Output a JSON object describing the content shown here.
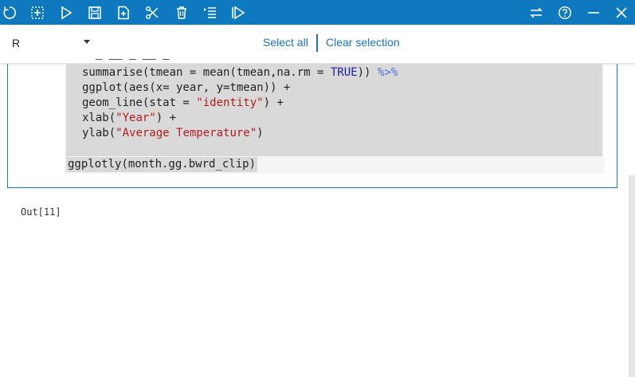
{
  "toolbar": {
    "icons": [
      "restart-kernel-icon",
      "insert-cell-icon",
      "run-icon",
      "save-icon",
      "new-notebook-icon",
      "cut-icon",
      "delete-icon",
      "run-all-icon",
      "run-all-below-icon",
      "sync-icon",
      "help-icon",
      "minimize-icon",
      "close-icon"
    ],
    "color": "#0f79c0"
  },
  "subbar": {
    "kernel": "R",
    "select_all": "Select all",
    "clear_selection": "Clear selection",
    "link_color": "#1a73c8"
  },
  "cell": {
    "line_partial": "    ",
    "l1a": "summarise(tmean = mean(tmean,na.rm = ",
    "l1b": "TRUE",
    "l1c": ")) ",
    "l1d": "%>%",
    "l2": "ggplot(aes(x= year, y=tmean)) +",
    "l3a": "geom_line(stat = ",
    "l3b": "\"identity\"",
    "l3c": ") +",
    "l4a": "xlab(",
    "l4b": "\"Year\"",
    "l4c": ") +",
    "l5a": "ylab(",
    "l5b": "\"Average Temperature\"",
    "l5c": ")",
    "last_line": "ggplotly(month.gg.bwrd_clip)"
  },
  "output": {
    "label": "Out[11]"
  }
}
